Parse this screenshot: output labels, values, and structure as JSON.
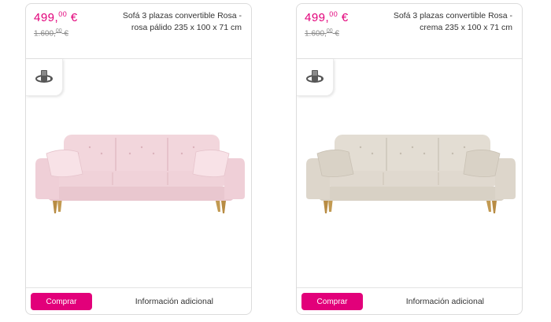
{
  "products": [
    {
      "price_main": "499,",
      "price_cents": "00",
      "price_currency": "€",
      "old_price_main": "1.600,",
      "old_price_cents": "00",
      "old_price_currency": "€",
      "title": "Sofá 3 plazas convertible Rosa - rosa pálido 235 x 100 x 71 cm",
      "buy_label": "Comprar",
      "info_label": "Información adicional",
      "icon": "rotate-360-icon",
      "colors": {
        "body": "#f2d6dc",
        "shadow": "#e2bcc4",
        "cushion": "#f8e2e7"
      }
    },
    {
      "price_main": "499,",
      "price_cents": "00",
      "price_currency": "€",
      "old_price_main": "1.600,",
      "old_price_cents": "00",
      "old_price_currency": "€",
      "title": "Sofá 3 plazas convertible Rosa - crema 235 x 100 x 71 cm",
      "buy_label": "Comprar",
      "info_label": "Información adicional",
      "icon": "rotate-360-icon",
      "colors": {
        "body": "#e3ddd3",
        "shadow": "#cdc6ba",
        "cushion": "#ebe6de"
      }
    }
  ],
  "accent_color": "#e2007a"
}
